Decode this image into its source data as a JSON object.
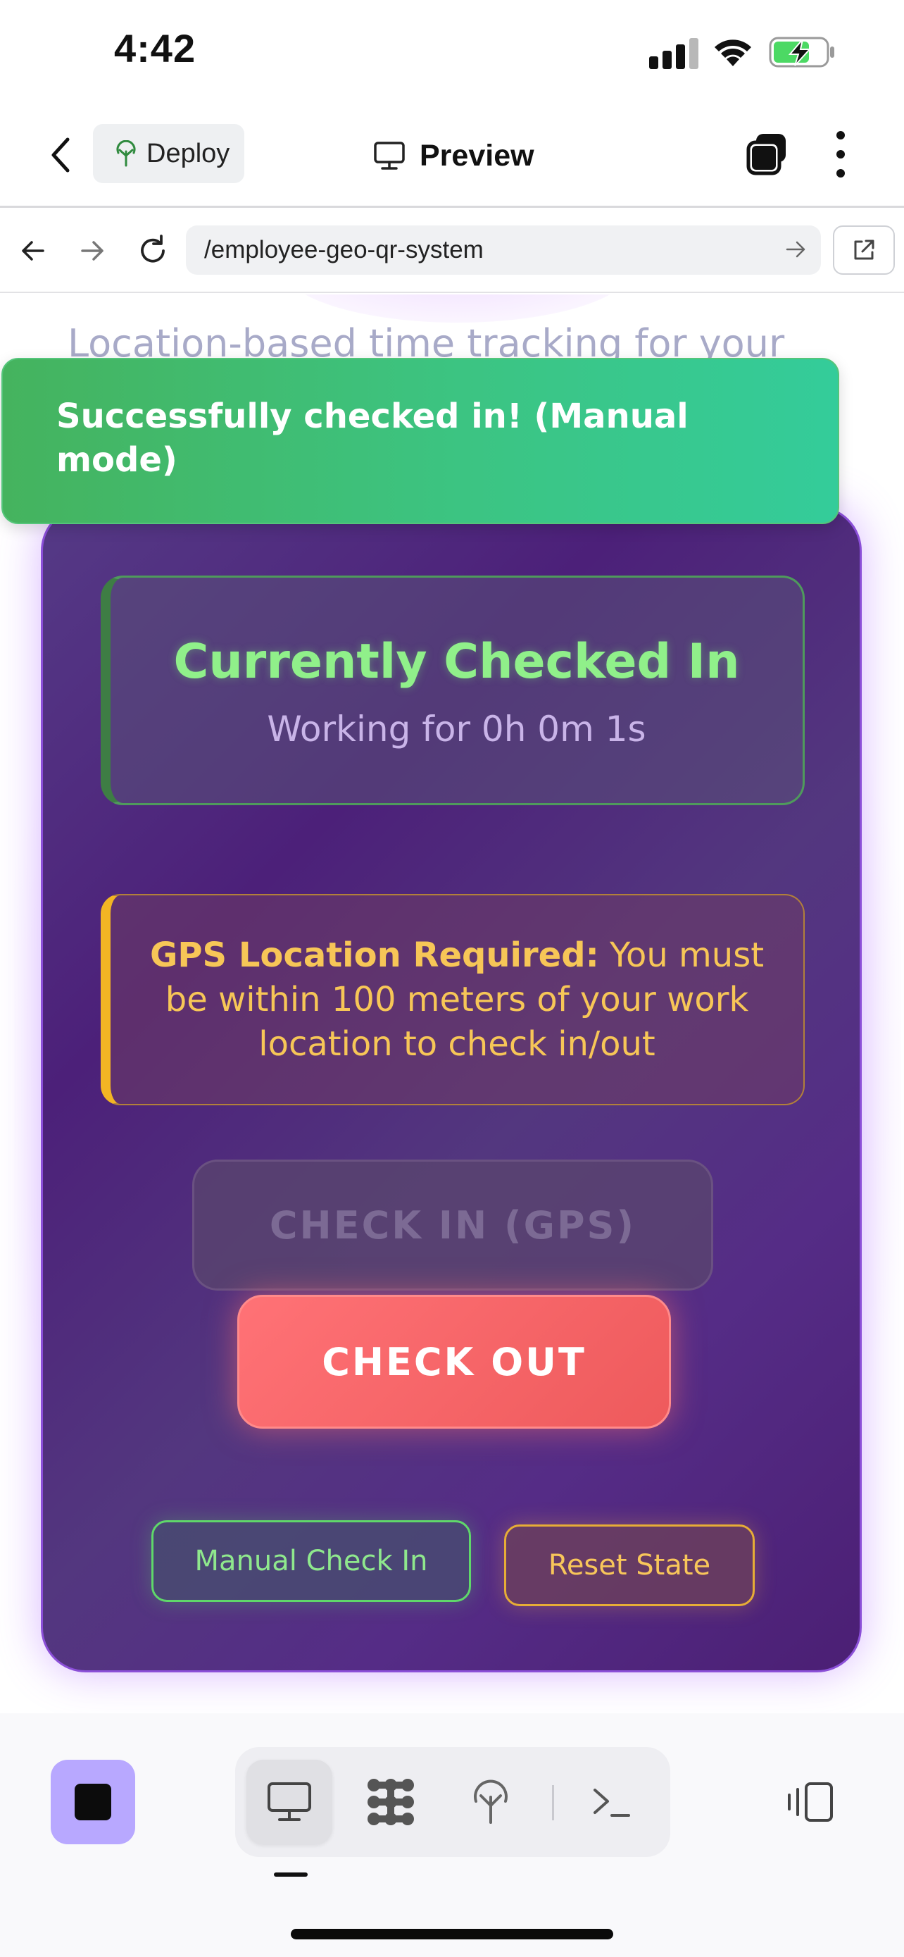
{
  "status_bar": {
    "time": "4:42"
  },
  "header": {
    "deploy_label": "Deploy",
    "preview_label": "Preview"
  },
  "browser": {
    "url": "/employee-geo-qr-system"
  },
  "page": {
    "subtitle": "Location-based time tracking for your",
    "toast": "Successfully checked in! (Manual mode)",
    "status": {
      "title": "Currently Checked In",
      "duration": "Working for 0h 0m 1s"
    },
    "warning": {
      "label": "GPS Location Required:",
      "text": " You must be within 100 meters of your work location to check in/out"
    },
    "buttons": {
      "check_in_gps": "CHECK IN (GPS)",
      "check_out": "CHECK OUT",
      "manual_check_in": "Manual Check In",
      "reset_state": "Reset State"
    }
  },
  "colors": {
    "card_bg": "#4c2079",
    "checked_in_green": "#90f08a",
    "warning_amber": "#f7c657",
    "checkout_red": "#ee5a5c",
    "toast_green": "#3cc482",
    "stop_button": "#b8a8ff"
  },
  "icons": {
    "deploy": "deploy-tree-icon",
    "preview": "monitor-icon",
    "tabs": "tabs-icon",
    "more": "more-vertical-icon",
    "modes": [
      "monitor-icon",
      "integrations-icon",
      "deploy-tree-icon",
      "terminal-icon"
    ],
    "panel": "panel-toggle-icon"
  }
}
